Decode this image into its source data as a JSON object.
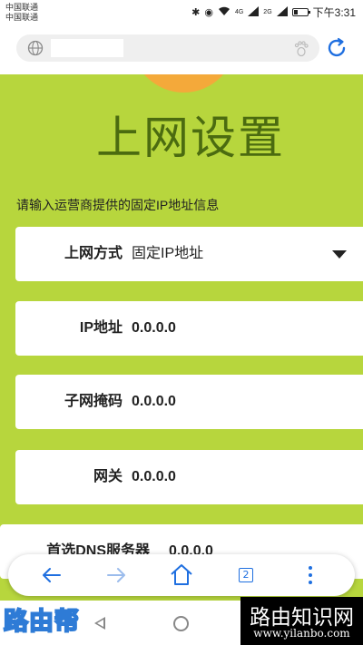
{
  "status_bar": {
    "carrier1": "中国联通",
    "carrier2": "中国联通",
    "network1": "4G",
    "network2": "2G",
    "time": "下午3:31",
    "icons": [
      "bluetooth-icon",
      "eye-icon",
      "wifi-icon",
      "signal-icon",
      "battery-icon"
    ]
  },
  "browser": {
    "url_text": "",
    "icons": [
      "globe-icon",
      "paw-icon",
      "refresh-icon"
    ]
  },
  "page": {
    "title": "上网设置",
    "intro": "请输入运营商提供的固定IP地址信息",
    "fields": [
      {
        "label": "上网方式",
        "value": "固定IP地址"
      },
      {
        "label": "IP地址",
        "value": "0.0.0.0"
      },
      {
        "label": "子网掩码",
        "value": "0.0.0.0"
      },
      {
        "label": "网关",
        "value": "0.0.0.0"
      },
      {
        "label": "首选DNS服务器",
        "value": "0.0.0.0"
      }
    ]
  },
  "toolbar": {
    "tab_count": "2",
    "icons": [
      "back-arrow-icon",
      "forward-arrow-icon",
      "home-icon",
      "tabs-icon",
      "more-icon"
    ]
  },
  "watermark": {
    "left": "路由帮",
    "right_title": "路由知识网",
    "right_url": "www.yilanbo.com"
  },
  "colors": {
    "page_bg": "#b7d63d",
    "title": "#4b6b10",
    "accent_blue": "#1f6fe0",
    "sun": "#f4a93a"
  }
}
